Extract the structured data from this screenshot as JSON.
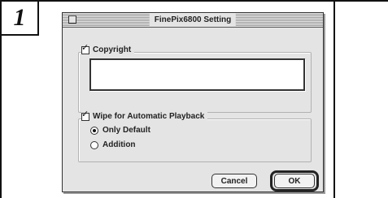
{
  "step": {
    "number": "1"
  },
  "dialog": {
    "title": "FinePix6800 Setting",
    "copyright": {
      "label": "Copyright",
      "checked": true,
      "value": ""
    },
    "wipe": {
      "label": "Wipe for Automatic Playback",
      "checked": true,
      "options": [
        {
          "label": "Only Default",
          "selected": true
        },
        {
          "label": "Addition",
          "selected": false
        }
      ]
    },
    "buttons": {
      "cancel_label": "Cancel",
      "ok_label": "OK"
    }
  },
  "icons": {
    "close_box": "close-box-icon",
    "check": "checkmark-icon",
    "radio": "radio-icon"
  },
  "colors": {
    "dialog_bg": "#e4e4e4",
    "frame": "#111111"
  }
}
